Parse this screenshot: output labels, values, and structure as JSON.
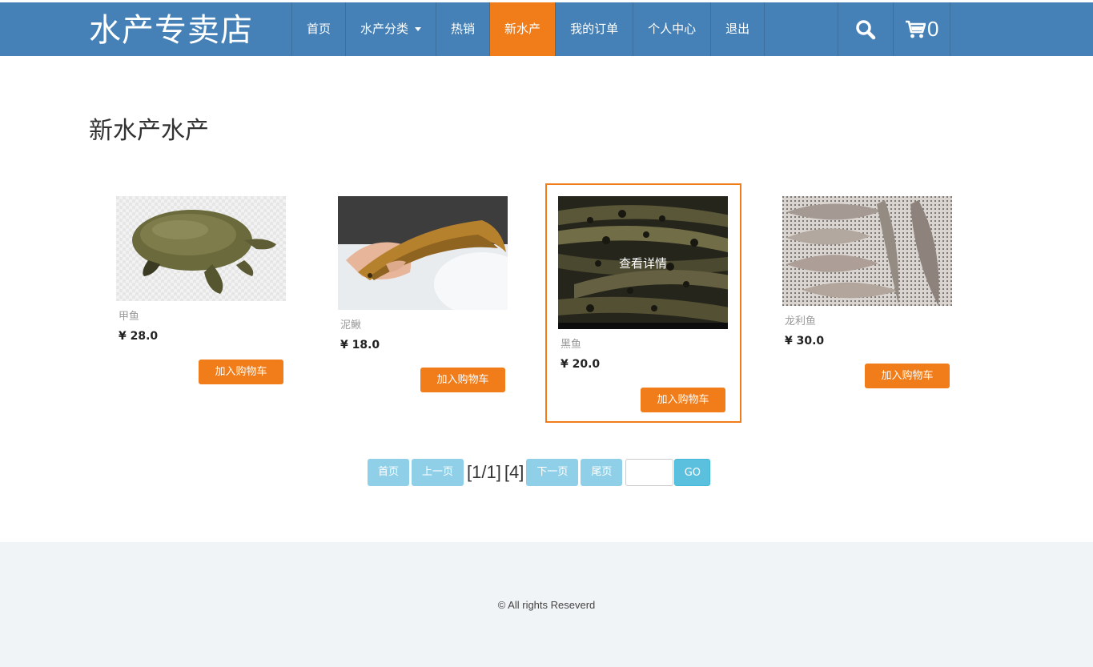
{
  "header": {
    "brand": "水产专卖店",
    "nav": [
      {
        "label": "首页"
      },
      {
        "label": "水产分类"
      },
      {
        "label": "热销"
      },
      {
        "label": "新水产"
      },
      {
        "label": "我的订单"
      },
      {
        "label": "个人中心"
      },
      {
        "label": "退出"
      }
    ],
    "active_nav": "新水产",
    "cart_count": "0",
    "icons": {
      "search": "search-icon",
      "cart": "shopping-cart-icon",
      "dropdown": "caret-down-icon"
    }
  },
  "main": {
    "title": "新水产水产",
    "detail_overlay": "查看详情",
    "add_to_cart_label": "加入购物车",
    "products": [
      {
        "name": "甲鱼",
        "price": "¥ 28.0"
      },
      {
        "name": "泥鳅",
        "price": "¥ 18.0"
      },
      {
        "name": "黑鱼",
        "price": "¥ 20.0"
      },
      {
        "name": "龙利鱼",
        "price": "¥ 30.0"
      }
    ]
  },
  "pagination": {
    "first": "首页",
    "prev": "上一页",
    "page_info": "[1/1]",
    "total": "[4]",
    "next": "下一页",
    "last": "尾页",
    "page_input": "",
    "go": "GO"
  },
  "footer": {
    "copyright": "© All rights Reseverd"
  },
  "colors": {
    "navbar": "#4581b6",
    "accent": "#f07c1a",
    "pager": "#8fd0e8",
    "go": "#5bc0de",
    "footer": "#f1f4f6"
  }
}
